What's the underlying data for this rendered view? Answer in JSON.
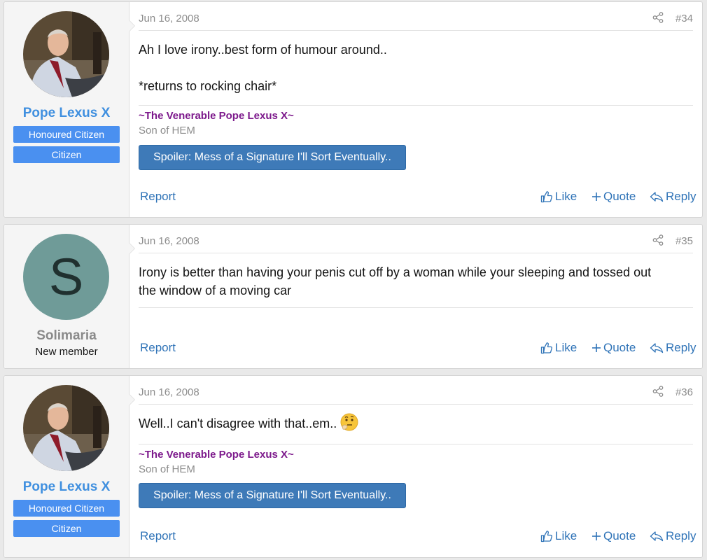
{
  "posts": [
    {
      "user": {
        "name": "Pope Lexus X",
        "banners": [
          "Honoured Citizen",
          "Citizen"
        ]
      },
      "date": "Jun 16, 2008",
      "number": "#34",
      "body": [
        "Ah I love irony..best form of humour around..",
        "*returns to rocking chair*"
      ],
      "signature": {
        "name": "~The Venerable Pope Lexus X~",
        "sub": "Son of HEM",
        "spoiler": "Spoiler: Mess of a Signature I'll Sort Eventually.."
      },
      "actions": {
        "report": "Report",
        "like": "Like",
        "quote": "Quote",
        "reply": "Reply"
      }
    },
    {
      "user": {
        "name": "Solimaria",
        "title": "New member",
        "avatar_letter": "S"
      },
      "date": "Jun 16, 2008",
      "number": "#35",
      "body": [
        "Irony is better than having your penis cut off by a woman while your sleeping and tossed out",
        "the window of a moving car"
      ],
      "actions": {
        "report": "Report",
        "like": "Like",
        "quote": "Quote",
        "reply": "Reply"
      }
    },
    {
      "user": {
        "name": "Pope Lexus X",
        "banners": [
          "Honoured Citizen",
          "Citizen"
        ]
      },
      "date": "Jun 16, 2008",
      "number": "#36",
      "body": [
        "Well..I can't disagree with that..em.."
      ],
      "emoji": "thinking-face-icon",
      "signature": {
        "name": "~The Venerable Pope Lexus X~",
        "sub": "Son of HEM",
        "spoiler": "Spoiler: Mess of a Signature I'll Sort Eventually.."
      },
      "actions": {
        "report": "Report",
        "like": "Like",
        "quote": "Quote",
        "reply": "Reply"
      }
    }
  ],
  "colors": {
    "username_blue": "#3f8fdf",
    "username_grey": "#8a8a8a",
    "banner": "#4a90f0",
    "signature": "#7d1a8c",
    "spoiler": "#3e7ab8",
    "link": "#2f73b7"
  }
}
